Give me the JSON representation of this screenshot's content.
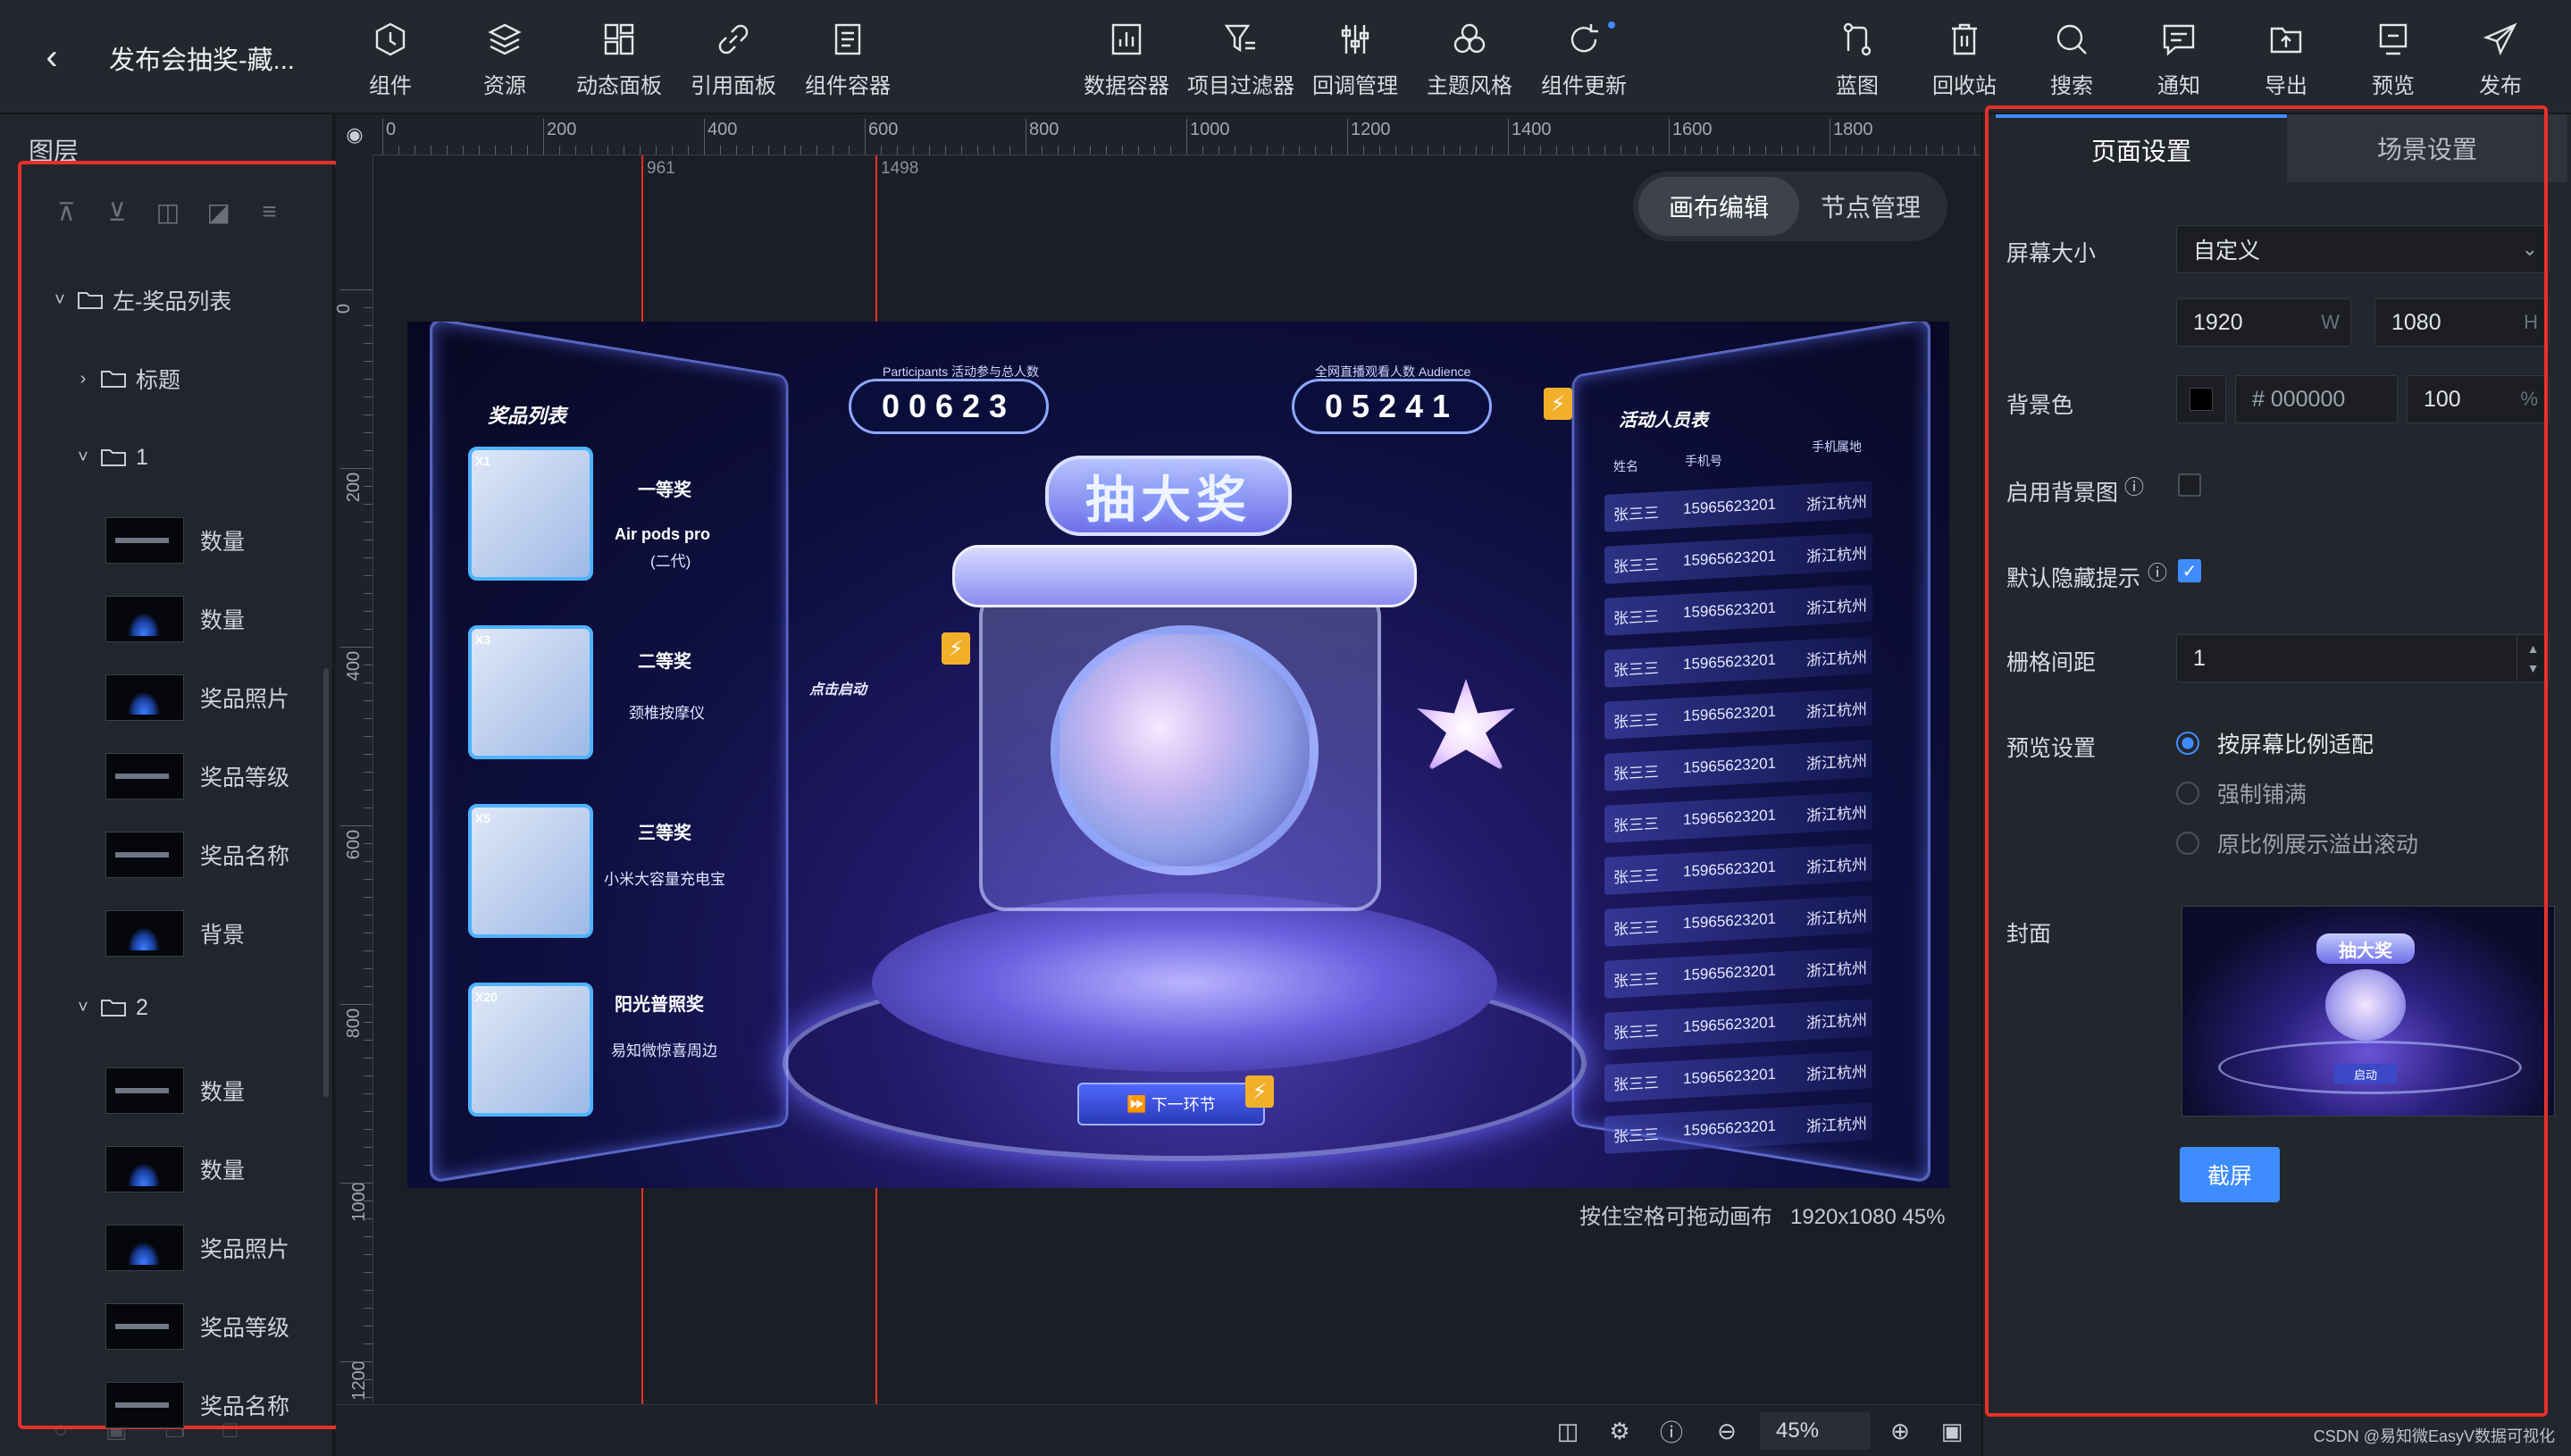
{
  "header": {
    "title": "发布会抽奖-藏...",
    "left_tools": [
      "组件",
      "资源",
      "动态面板",
      "引用面板",
      "组件容器"
    ],
    "mid_tools": [
      "数据容器",
      "项目过滤器",
      "回调管理",
      "主题风格",
      "组件更新"
    ],
    "right_tools": [
      "蓝图",
      "回收站",
      "搜索",
      "通知",
      "导出",
      "预览",
      "发布"
    ]
  },
  "left_panel": {
    "title": "图层",
    "tree": [
      {
        "label": "左-奖品列表",
        "kind": "folder",
        "level": 0,
        "open": true
      },
      {
        "label": "标题",
        "kind": "folder",
        "level": 1,
        "open": false
      },
      {
        "label": "1",
        "kind": "folder",
        "level": 1,
        "open": true
      },
      {
        "label": "数量",
        "kind": "text",
        "level": 2
      },
      {
        "label": "数量",
        "kind": "image",
        "level": 2
      },
      {
        "label": "奖品照片",
        "kind": "image",
        "level": 2
      },
      {
        "label": "奖品等级",
        "kind": "text",
        "level": 2
      },
      {
        "label": "奖品名称",
        "kind": "text",
        "level": 2
      },
      {
        "label": "背景",
        "kind": "image",
        "level": 2
      },
      {
        "label": "2",
        "kind": "folder",
        "level": 1,
        "open": true
      },
      {
        "label": "数量",
        "kind": "text",
        "level": 2
      },
      {
        "label": "数量",
        "kind": "image",
        "level": 2
      },
      {
        "label": "奖品照片",
        "kind": "image",
        "level": 2
      },
      {
        "label": "奖品等级",
        "kind": "text",
        "level": 2
      },
      {
        "label": "奖品名称",
        "kind": "text",
        "level": 2
      }
    ]
  },
  "canvas": {
    "ruler_top": [
      "0",
      "200",
      "400",
      "600",
      "800",
      "1000",
      "1200",
      "1400",
      "1600",
      "1800"
    ],
    "ruler_left": [
      "0",
      "200",
      "400",
      "600",
      "800",
      "1000",
      "1200"
    ],
    "guides": [
      "961",
      "1498"
    ],
    "mode_tabs": {
      "active": "画布编辑",
      "other": "节点管理"
    },
    "hint": "按住空格可拖动画布",
    "size_info": "1920x1080 45%",
    "zoom": "45%",
    "art": {
      "main_title": "抽大奖",
      "prize_list_title": "奖品列表",
      "participants_caption": "Participants 活动参与总人数",
      "participants_count": "00623",
      "audience_caption": "全网直播观看人数 Audience",
      "audience_count": "05241",
      "roster_title": "活动人员表",
      "roster_cols": [
        "姓名",
        "手机号",
        "手机属地"
      ],
      "roster_row": {
        "name": "张三三",
        "phone": "15965623201",
        "place": "浙江杭州"
      },
      "click_label": "点击启动",
      "next_button": "下一环节",
      "prizes": [
        {
          "badge": "X1",
          "level": "一等奖",
          "name": "Air pods pro",
          "sub": "(二代)"
        },
        {
          "badge": "X3",
          "level": "二等奖",
          "name": "颈椎按摩仪",
          "sub": ""
        },
        {
          "badge": "X5",
          "level": "三等奖",
          "name": "小米大容量充电宝",
          "sub": ""
        },
        {
          "badge": "X20",
          "level": "阳光普照奖",
          "name": "易知微惊喜周边",
          "sub": ""
        }
      ]
    }
  },
  "right_panel": {
    "tabs": {
      "active": "页面设置",
      "other": "场景设置"
    },
    "screen_size_label": "屏幕大小",
    "screen_size_value": "自定义",
    "width": "1920",
    "width_unit": "W",
    "height": "1080",
    "height_unit": "H",
    "bg_label": "背景色",
    "bg_hex": "# 000000",
    "bg_opacity": "100",
    "opacity_unit": "%",
    "bg_image_label": "启用背景图",
    "hide_tip_label": "默认隐藏提示",
    "grid_label": "栅格间距",
    "grid_value": "1",
    "preview_label": "预览设置",
    "preview_options": [
      {
        "label": "按屏幕比例适配",
        "selected": true
      },
      {
        "label": "强制铺满",
        "selected": false
      },
      {
        "label": "原比例展示溢出滚动",
        "selected": false
      }
    ],
    "cover_label": "封面",
    "cover_title": "抽大奖",
    "cover_button_text": "启动",
    "screenshot_button": "截屏"
  },
  "watermark": "CSDN @易知微EasyV数据可视化",
  "colors": {
    "accent": "#3f8cff",
    "highlight": "#e8302a"
  }
}
